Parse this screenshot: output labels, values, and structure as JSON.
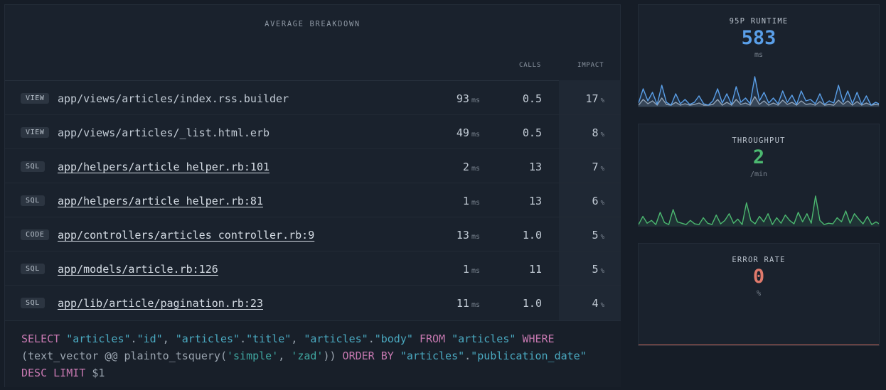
{
  "breakdown": {
    "title": "AVERAGE BREAKDOWN",
    "col_calls": "CALLS",
    "col_impact": "IMPACT",
    "rows": [
      {
        "tag": "VIEW",
        "path": "app/views/articles/index.rss.builder",
        "link": false,
        "duration": "93",
        "duration_unit": "ms",
        "calls": "0.5",
        "impact": "17",
        "impact_unit": "%"
      },
      {
        "tag": "VIEW",
        "path": "app/views/articles/_list.html.erb",
        "link": false,
        "duration": "49",
        "duration_unit": "ms",
        "calls": "0.5",
        "impact": "8",
        "impact_unit": "%"
      },
      {
        "tag": "SQL",
        "path": "app/helpers/article_helper.rb:101",
        "link": true,
        "duration": "2",
        "duration_unit": "ms",
        "calls": "13",
        "impact": "7",
        "impact_unit": "%"
      },
      {
        "tag": "SQL",
        "path": "app/helpers/article_helper.rb:81",
        "link": true,
        "duration": "1",
        "duration_unit": "ms",
        "calls": "13",
        "impact": "6",
        "impact_unit": "%"
      },
      {
        "tag": "CODE",
        "path": "app/controllers/articles_controller.rb:9",
        "link": true,
        "duration": "13",
        "duration_unit": "ms",
        "calls": "1.0",
        "impact": "5",
        "impact_unit": "%"
      },
      {
        "tag": "SQL",
        "path": "app/models/article.rb:126",
        "link": true,
        "duration": "1",
        "duration_unit": "ms",
        "calls": "11",
        "impact": "5",
        "impact_unit": "%"
      },
      {
        "tag": "SQL",
        "path": "app/lib/article/pagination.rb:23",
        "link": true,
        "duration": "11",
        "duration_unit": "ms",
        "calls": "1.0",
        "impact": "4",
        "impact_unit": "%"
      }
    ],
    "sql_tokens": [
      {
        "t": "SELECT",
        "c": "kw"
      },
      {
        "t": " ",
        "c": "plain"
      },
      {
        "t": "\"articles\"",
        "c": "id"
      },
      {
        "t": ".",
        "c": "plain"
      },
      {
        "t": "\"id\"",
        "c": "id"
      },
      {
        "t": ", ",
        "c": "plain"
      },
      {
        "t": "\"articles\"",
        "c": "id"
      },
      {
        "t": ".",
        "c": "plain"
      },
      {
        "t": "\"title\"",
        "c": "id"
      },
      {
        "t": ", ",
        "c": "plain"
      },
      {
        "t": "\"articles\"",
        "c": "id"
      },
      {
        "t": ".",
        "c": "plain"
      },
      {
        "t": "\"body\"",
        "c": "id"
      },
      {
        "t": " ",
        "c": "plain"
      },
      {
        "t": "FROM",
        "c": "kw"
      },
      {
        "t": " ",
        "c": "plain"
      },
      {
        "t": "\"articles\"",
        "c": "id"
      },
      {
        "t": " ",
        "c": "plain"
      },
      {
        "t": "WHERE",
        "c": "kw"
      },
      {
        "t": " ",
        "c": "plain"
      },
      {
        "t": "(text_vector @@ plainto_tsquery(",
        "c": "plain"
      },
      {
        "t": "'simple'",
        "c": "str"
      },
      {
        "t": ", ",
        "c": "plain"
      },
      {
        "t": "'zad'",
        "c": "str"
      },
      {
        "t": ")) ",
        "c": "plain"
      },
      {
        "t": "ORDER BY",
        "c": "kw"
      },
      {
        "t": " ",
        "c": "plain"
      },
      {
        "t": "\"articles\"",
        "c": "id"
      },
      {
        "t": ".",
        "c": "plain"
      },
      {
        "t": "\"publication_date\"",
        "c": "id"
      },
      {
        "t": " ",
        "c": "plain"
      },
      {
        "t": "DESC",
        "c": "kw"
      },
      {
        "t": " ",
        "c": "plain"
      },
      {
        "t": "LIMIT",
        "c": "kw"
      },
      {
        "t": " $1",
        "c": "plain"
      }
    ]
  },
  "metrics": {
    "runtime": {
      "label": "95P RUNTIME",
      "value": "583",
      "unit": "ms",
      "color": "#5a9fe8"
    },
    "throughput": {
      "label": "THROUGHPUT",
      "value": "2",
      "unit": "/min",
      "color": "#4cb870"
    },
    "error_rate": {
      "label": "ERROR RATE",
      "value": "0",
      "unit": "%",
      "color": "#e07a6c"
    }
  },
  "sparklines": {
    "runtime_primary": [
      5,
      25,
      8,
      20,
      3,
      30,
      6,
      2,
      18,
      4,
      10,
      3,
      6,
      15,
      4,
      2,
      8,
      25,
      5,
      18,
      3,
      28,
      6,
      12,
      4,
      42,
      8,
      20,
      5,
      12,
      4,
      22,
      6,
      16,
      3,
      22,
      8,
      10,
      4,
      18,
      3,
      8,
      5,
      30,
      6,
      22,
      4,
      20,
      3,
      15,
      2,
      6,
      3
    ],
    "runtime_secondary": [
      2,
      10,
      4,
      8,
      2,
      12,
      3,
      2,
      6,
      2,
      4,
      2,
      3,
      5,
      2,
      2,
      3,
      10,
      2,
      6,
      2,
      10,
      3,
      5,
      2,
      14,
      3,
      8,
      2,
      5,
      2,
      9,
      3,
      6,
      2,
      8,
      3,
      4,
      2,
      7,
      2,
      3,
      2,
      9,
      3,
      8,
      2,
      7,
      2,
      5,
      2,
      3,
      2
    ],
    "throughput": [
      2,
      14,
      4,
      8,
      2,
      20,
      5,
      2,
      24,
      6,
      4,
      2,
      8,
      3,
      2,
      12,
      4,
      2,
      16,
      3,
      8,
      18,
      4,
      10,
      2,
      34,
      8,
      3,
      14,
      6,
      18,
      2,
      12,
      4,
      16,
      8,
      3,
      20,
      6,
      18,
      4,
      44,
      8,
      2,
      4,
      3,
      12,
      6,
      22,
      4,
      18,
      10,
      3,
      14,
      2,
      6,
      2
    ]
  }
}
